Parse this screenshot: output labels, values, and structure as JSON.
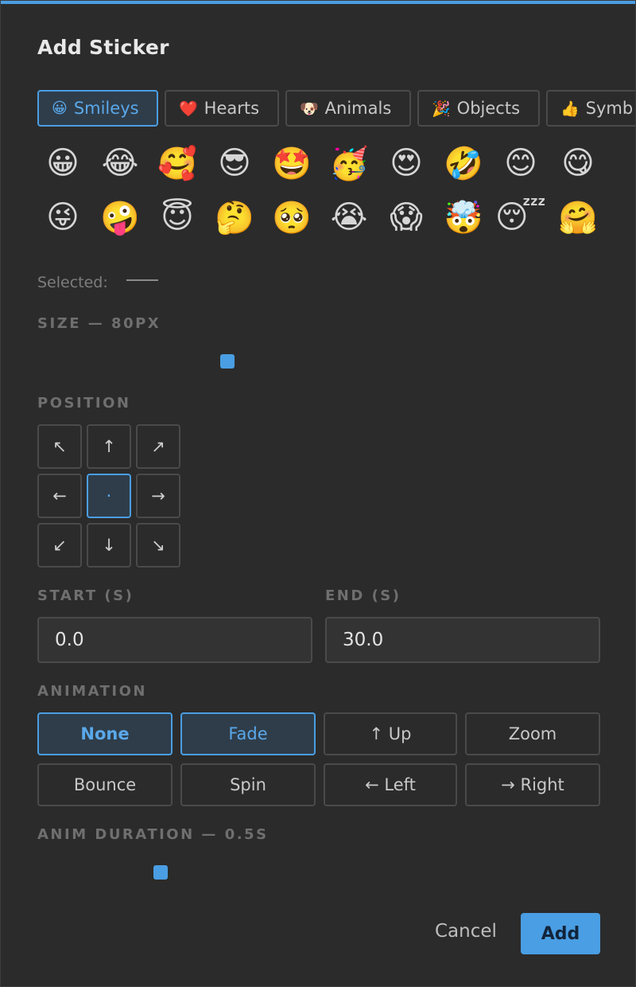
{
  "dialog": {
    "title": "Add Sticker",
    "accent_color": "#4a9ee3"
  },
  "tabs": [
    {
      "icon": "😀",
      "label": "Smileys",
      "active": true
    },
    {
      "icon": "❤️",
      "label": "Hearts",
      "active": false
    },
    {
      "icon": "🐶",
      "label": "Animals",
      "active": false
    },
    {
      "icon": "🎉",
      "label": "Objects",
      "active": false
    },
    {
      "icon": "👍",
      "label": "Symb",
      "active": false
    }
  ],
  "emojis": [
    "😀",
    "😂",
    "🥰",
    "😎",
    "🤩",
    "🥳",
    "😍",
    "🤣",
    "😊",
    "😋",
    "😜",
    "🤪",
    "😇",
    "🤔",
    "🥺",
    "😭",
    "😱",
    "🤯",
    "😴",
    "🤗"
  ],
  "selected": {
    "label": "Selected:",
    "value": ""
  },
  "size": {
    "label": "SIZE — 80PX",
    "value": 80
  },
  "position": {
    "label": "POSITION",
    "cells": [
      "↖",
      "↑",
      "↗",
      "←",
      "·",
      "→",
      "↙",
      "↓",
      "↘"
    ],
    "selected_index": 4
  },
  "timing": {
    "start_label": "START (S)",
    "start_value": "0.0",
    "end_label": "END (S)",
    "end_value": "30.0"
  },
  "animation": {
    "label": "ANIMATION",
    "options": [
      "None",
      "Fade",
      "↑ Up",
      "Zoom",
      "Bounce",
      "Spin",
      "← Left",
      "→ Right"
    ]
  },
  "anim_duration": {
    "label": "ANIM DURATION — 0.5S",
    "value": 0.5
  },
  "actions": {
    "cancel": "Cancel",
    "add": "Add"
  }
}
